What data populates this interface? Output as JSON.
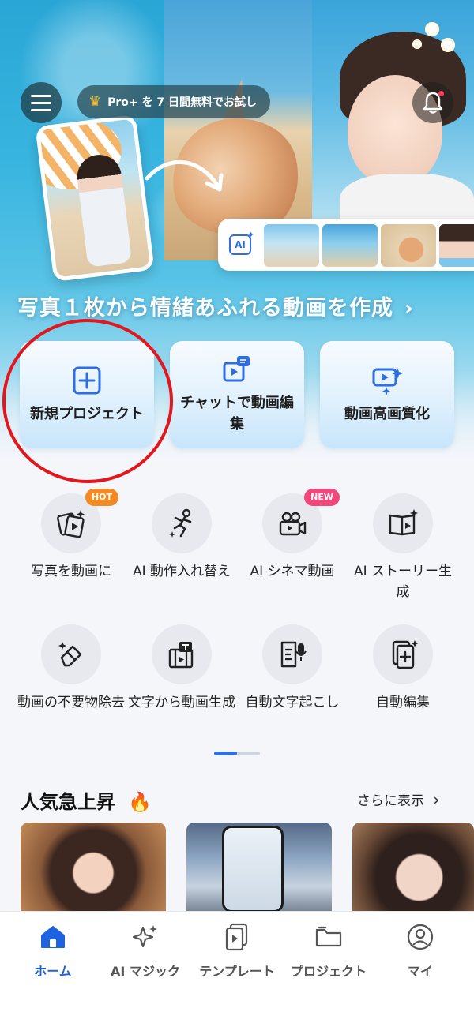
{
  "header": {
    "promo_text": "Pro+ を 7 日間無料でお試し"
  },
  "hero": {
    "ai_chip": "AI",
    "headline": "写真１枚から情緒あふれる動画を作成",
    "headline_chevron": "›"
  },
  "actions": [
    {
      "label": "新規プロジェクト",
      "icon": "plus-square-icon"
    },
    {
      "label": "チャットで動画編集",
      "icon": "chat-video-icon"
    },
    {
      "label": "動画高画質化",
      "icon": "video-enhance-icon"
    }
  ],
  "features": [
    {
      "label": "写真を動画に",
      "icon": "photo-to-video-icon",
      "tag": "HOT"
    },
    {
      "label": "AI 動作入れ替え",
      "icon": "dance-motion-icon",
      "tag": ""
    },
    {
      "label": "AI シネマ動画",
      "icon": "cinema-camera-icon",
      "tag": "NEW"
    },
    {
      "label": "AI ストーリー生成",
      "icon": "story-book-icon",
      "tag": ""
    },
    {
      "label": "動画の不要物除去",
      "icon": "eraser-icon",
      "tag": ""
    },
    {
      "label": "文字から動画生成",
      "icon": "text-to-video-icon",
      "tag": ""
    },
    {
      "label": "自動文字起こし",
      "icon": "transcribe-mic-icon",
      "tag": ""
    },
    {
      "label": "自動編集",
      "icon": "auto-edit-icon",
      "tag": ""
    }
  ],
  "trending": {
    "title": "人気急上昇",
    "more": "さらに表示",
    "chevron": "›"
  },
  "tabs": [
    {
      "label": "ホーム",
      "icon": "home-icon",
      "active": true
    },
    {
      "label": "AI マジック",
      "icon": "sparkle-icon",
      "active": false
    },
    {
      "label": "テンプレート",
      "icon": "template-icon",
      "active": false
    },
    {
      "label": "プロジェクト",
      "icon": "folder-icon",
      "active": false
    },
    {
      "label": "マイ",
      "icon": "user-icon",
      "active": false
    }
  ],
  "colors": {
    "accent": "#1d63df",
    "highlight_circle": "#e2161c",
    "hot_tag": "#f28b24",
    "new_tag": "#f2477a"
  }
}
